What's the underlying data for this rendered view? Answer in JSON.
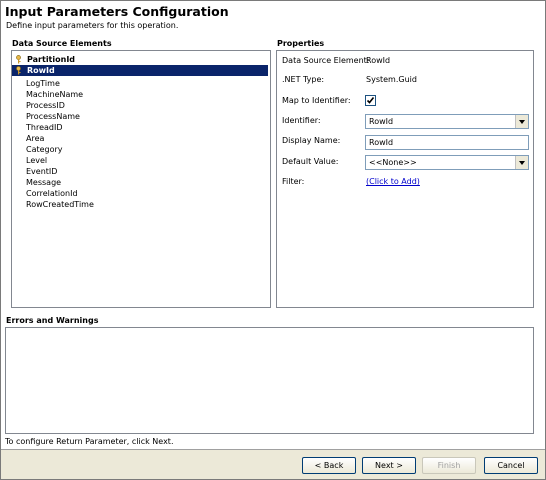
{
  "header": {
    "title": "Input Parameters Configuration",
    "subtitle": "Define input parameters for this operation."
  },
  "data_source": {
    "label": "Data Source Elements",
    "items": [
      {
        "label": "PartitionId",
        "key": true,
        "selected": false
      },
      {
        "label": "RowId",
        "key": true,
        "selected": true
      },
      {
        "label": "LogTime"
      },
      {
        "label": "MachineName"
      },
      {
        "label": "ProcessID"
      },
      {
        "label": "ProcessName"
      },
      {
        "label": "ThreadID"
      },
      {
        "label": "Area"
      },
      {
        "label": "Category"
      },
      {
        "label": "Level"
      },
      {
        "label": "EventID"
      },
      {
        "label": "Message"
      },
      {
        "label": "CorrelationId"
      },
      {
        "label": "RowCreatedTime"
      }
    ]
  },
  "properties": {
    "label": "Properties",
    "data_source_element_label": "Data Source Element:",
    "data_source_element_value": "RowId",
    "net_type_label": ".NET Type:",
    "net_type_value": "System.Guid",
    "map_to_identifier_label": "Map to Identifier:",
    "map_to_identifier_checked": true,
    "identifier_label": "Identifier:",
    "identifier_value": "RowId",
    "display_name_label": "Display Name:",
    "display_name_value": "RowId",
    "default_value_label": "Default Value:",
    "default_value_value": "<<None>>",
    "filter_label": "Filter:",
    "filter_link": "(Click to Add)"
  },
  "errors": {
    "label": "Errors and Warnings"
  },
  "footer": {
    "message": "To configure Return Parameter, click Next."
  },
  "buttons": {
    "back": "< Back",
    "next": "Next >",
    "finish": "Finish",
    "cancel": "Cancel"
  }
}
